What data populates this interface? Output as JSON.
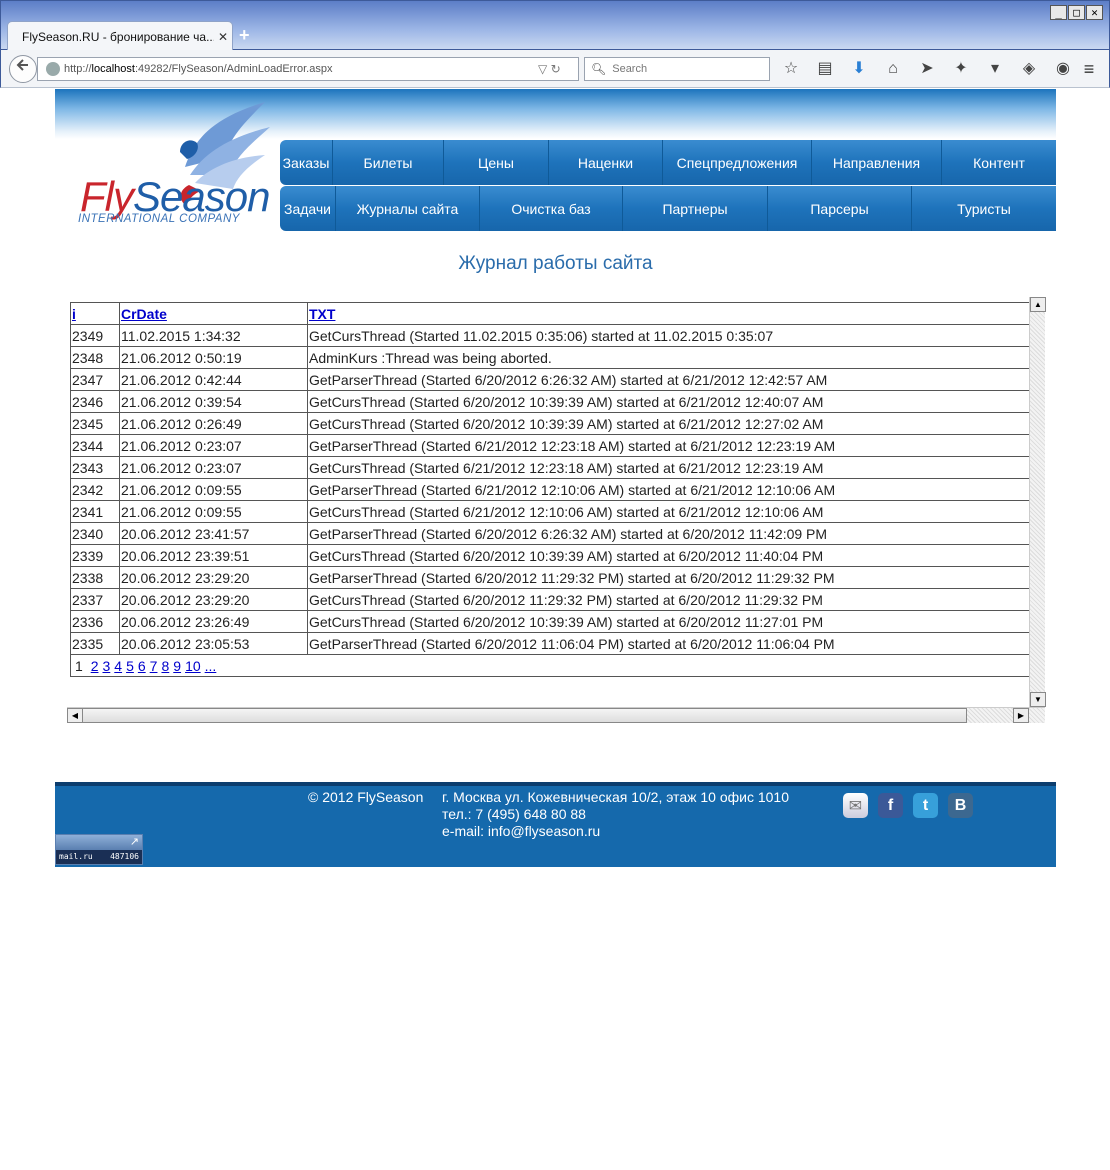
{
  "browser": {
    "tab_title": "FlySeason.RU - бронирование ча...",
    "tab_close": "✕",
    "new_tab": "+",
    "url_prefix": "http://",
    "url_host": "localhost",
    "url_rest": ":49282/FlySeason/AdminLoadError.aspx",
    "search_placeholder": "Search",
    "win_min": "_",
    "win_max": "□",
    "win_close": "✕"
  },
  "logo": {
    "fly": "Fly",
    "season": "Season",
    "subtitle": "INTERNATIONAL COMPANY"
  },
  "menu": {
    "row1": [
      "Заказы",
      "Билеты",
      "Цены",
      "Наценки",
      "Спецпредложения",
      "Направления",
      "Контент"
    ],
    "row2": [
      "Задачи",
      "Журналы сайта",
      "Очистка баз",
      "Партнеры",
      "Парсеры",
      "Туристы"
    ]
  },
  "page_title": "Журнал работы сайта",
  "grid": {
    "headers": [
      "i",
      "CrDate",
      "TXT"
    ],
    "rows": [
      [
        "2349",
        "11.02.2015 1:34:32",
        "GetCursThread (Started 11.02.2015 0:35:06) started at 11.02.2015 0:35:07"
      ],
      [
        "2348",
        "21.06.2012 0:50:19",
        "AdminKurs :Thread was being aborted."
      ],
      [
        "2347",
        "21.06.2012 0:42:44",
        "GetParserThread (Started 6/20/2012 6:26:32 AM) started at 6/21/2012 12:42:57 AM"
      ],
      [
        "2346",
        "21.06.2012 0:39:54",
        "GetCursThread (Started 6/20/2012 10:39:39 AM) started at 6/21/2012 12:40:07 AM"
      ],
      [
        "2345",
        "21.06.2012 0:26:49",
        "GetCursThread (Started 6/20/2012 10:39:39 AM) started at 6/21/2012 12:27:02 AM"
      ],
      [
        "2344",
        "21.06.2012 0:23:07",
        "GetParserThread (Started 6/21/2012 12:23:18 AM) started at 6/21/2012 12:23:19 AM"
      ],
      [
        "2343",
        "21.06.2012 0:23:07",
        "GetCursThread (Started 6/21/2012 12:23:18 AM) started at 6/21/2012 12:23:19 AM"
      ],
      [
        "2342",
        "21.06.2012 0:09:55",
        "GetParserThread (Started 6/21/2012 12:10:06 AM) started at 6/21/2012 12:10:06 AM"
      ],
      [
        "2341",
        "21.06.2012 0:09:55",
        "GetCursThread (Started 6/21/2012 12:10:06 AM) started at 6/21/2012 12:10:06 AM"
      ],
      [
        "2340",
        "20.06.2012 23:41:57",
        "GetParserThread (Started 6/20/2012 6:26:32 AM) started at 6/20/2012 11:42:09 PM"
      ],
      [
        "2339",
        "20.06.2012 23:39:51",
        "GetCursThread (Started 6/20/2012 10:39:39 AM) started at 6/20/2012 11:40:04 PM"
      ],
      [
        "2338",
        "20.06.2012 23:29:20",
        "GetParserThread (Started 6/20/2012 11:29:32 PM) started at 6/20/2012 11:29:32 PM"
      ],
      [
        "2337",
        "20.06.2012 23:29:20",
        "GetCursThread (Started 6/20/2012 11:29:32 PM) started at 6/20/2012 11:29:32 PM"
      ],
      [
        "2336",
        "20.06.2012 23:26:49",
        "GetCursThread (Started 6/20/2012 10:39:39 AM) started at 6/20/2012 11:27:01 PM"
      ],
      [
        "2335",
        "20.06.2012 23:05:53",
        "GetParserThread (Started 6/20/2012 11:06:04 PM) started at 6/20/2012 11:06:04 PM"
      ]
    ],
    "pager": {
      "current": "1",
      "links": [
        "2",
        "3",
        "4",
        "5",
        "6",
        "7",
        "8",
        "9",
        "10",
        "..."
      ]
    }
  },
  "footer": {
    "copyright": "© 2012 FlySeason",
    "address": "г. Москва ул. Кожевническая 10/2, этаж 10 офис 1010",
    "phone": "тел.: 7 (495) 648 80 88",
    "email": "e-mail: info@flyseason.ru",
    "counter_arrow": "↗",
    "counter_site": "mail.ru",
    "counter_value": "487106"
  }
}
